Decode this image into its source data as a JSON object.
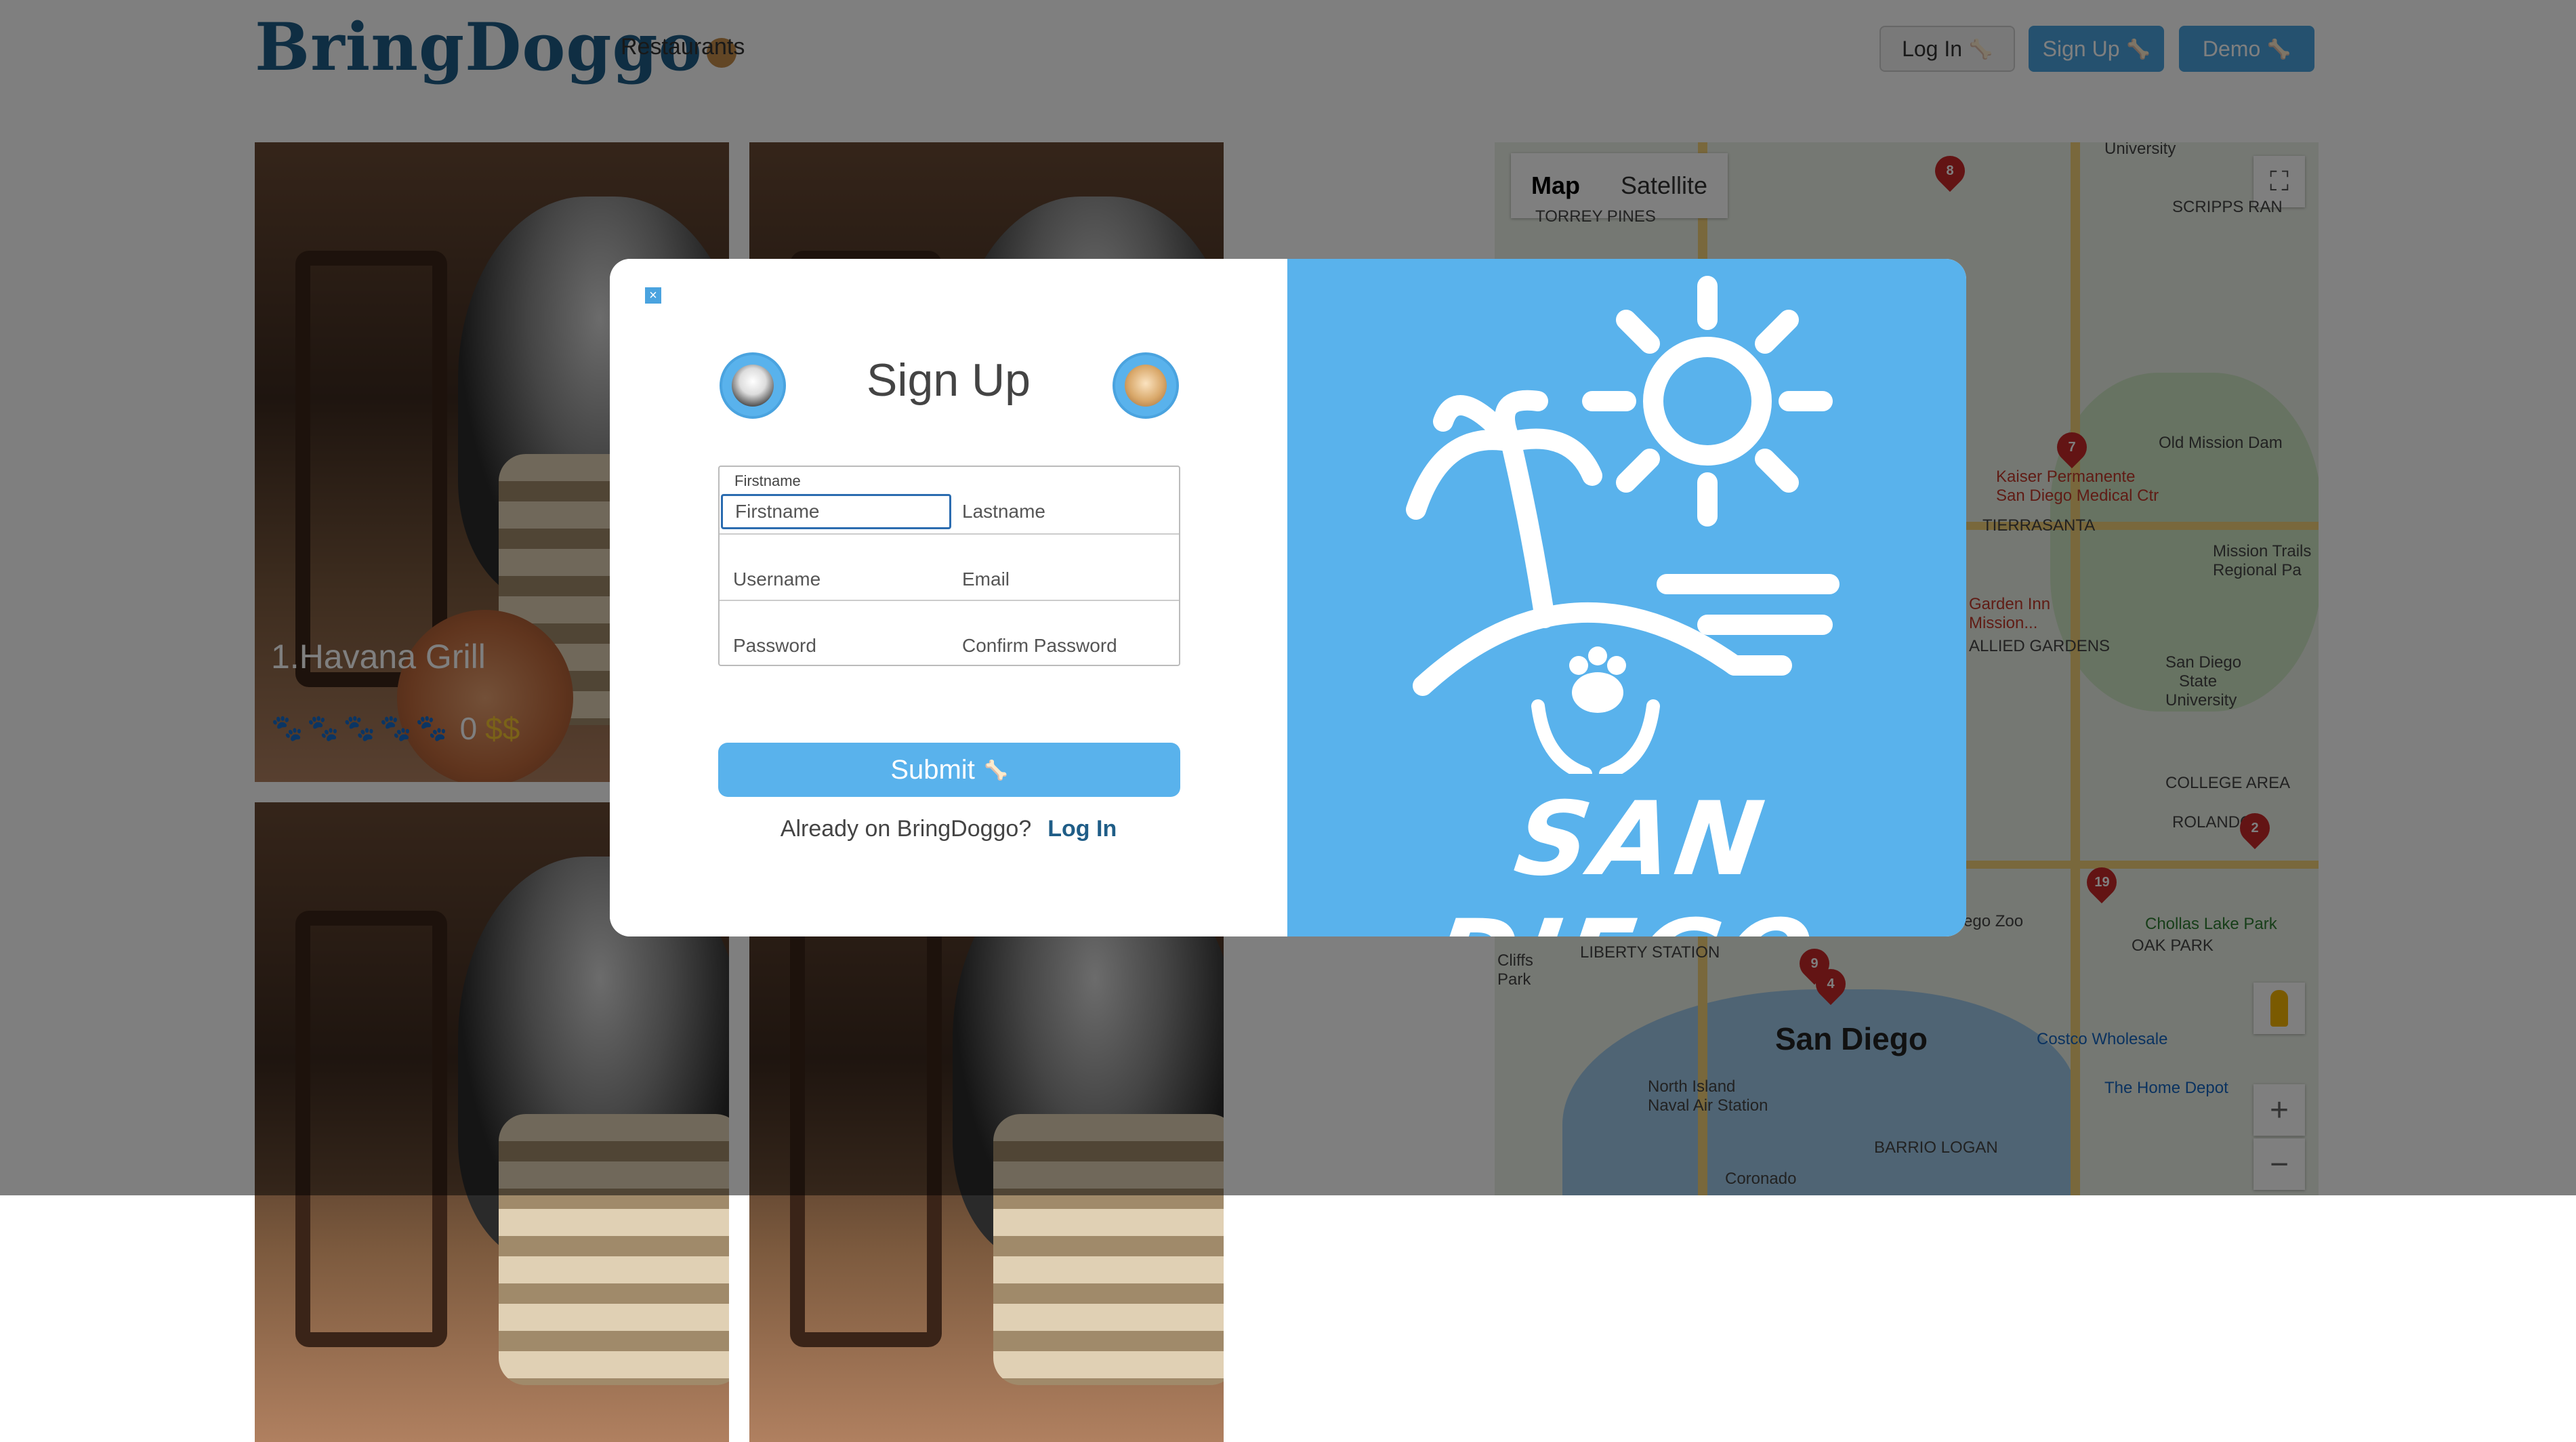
{
  "header": {
    "logo_text": "BringDoggo",
    "nav_restaurants": "Restaurants",
    "login_label": "Log In",
    "signup_label": "Sign Up",
    "demo_label": "Demo",
    "bone_icon": "🦴"
  },
  "cards": [
    {
      "title": "1.Havana Grill",
      "rating_paws": "🐾🐾🐾🐾🐾",
      "rating_value": "0",
      "price": "$$"
    },
    {
      "title": "",
      "rating_paws": "",
      "rating_value": "",
      "price": ""
    },
    {
      "title": "",
      "rating_paws": "",
      "rating_value": "",
      "price": ""
    },
    {
      "title": "",
      "rating_paws": "",
      "rating_value": "",
      "price": ""
    }
  ],
  "map": {
    "tabs": [
      "Map",
      "Satellite"
    ],
    "active_tab": "Map",
    "city_label": "San Diego",
    "labels": [
      "University",
      "TORREY PINES",
      "SCRIPPS RAN",
      "Old Mission Dam",
      "Kaiser Permanente",
      "San Diego Medical Ctr",
      "TIERRASANTA",
      "Mission Trails",
      "Regional Pa",
      "Garden Inn",
      "Mission...",
      "ALLIED GARDENS",
      "San Diego",
      "State",
      "University",
      "COLLEGE AREA",
      "ROLANDO",
      "Chollas Lake Park",
      "OAK PARK",
      "Cliffs",
      "Park",
      "LIBERTY STATION",
      "Costco Wholesale",
      "The Home Depot",
      "North Island",
      "Naval Air Station",
      "BARRIO LOGAN",
      "Coronado",
      "San Diego Zoo"
    ],
    "pins": [
      "8",
      "7",
      "2",
      "19",
      "9",
      "4"
    ],
    "zoom_in": "+",
    "zoom_out": "−",
    "fullscreen_icon": "⛶"
  },
  "modal": {
    "close_label": "×",
    "title": "Sign Up",
    "firstname_label": "Firstname",
    "fields": {
      "firstname": "Firstname",
      "lastname": "Lastname",
      "username": "Username",
      "email": "Email",
      "password": "Password",
      "confirm_password": "Confirm Password"
    },
    "submit_label": "Submit",
    "already_text": "Already on BringDoggo?",
    "login_link": "Log In",
    "art_text": "SAN DIEGO"
  },
  "colors": {
    "accent": "#4aa3df",
    "panel_blue": "#59b2ec",
    "logo_blue": "#1f5d87",
    "pin_red": "#c62828"
  }
}
